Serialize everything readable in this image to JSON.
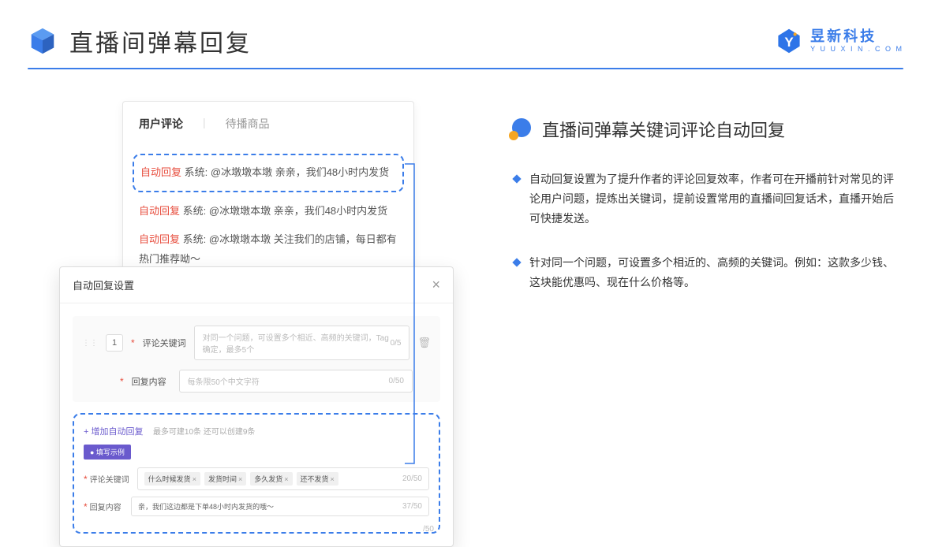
{
  "header": {
    "title": "直播间弹幕回复",
    "brand_cn": "昱新科技",
    "brand_en": "Y U U X I N . C O M"
  },
  "comments": {
    "tabs": {
      "active": "用户评论",
      "inactive": "待播商品"
    },
    "items": [
      {
        "tag": "自动回复",
        "sys": "系统:",
        "text": "@冰墩墩本墩 亲亲，我们48小时内发货"
      },
      {
        "tag": "自动回复",
        "sys": "系统:",
        "text": "@冰墩墩本墩 亲亲，我们48小时内发货"
      },
      {
        "tag": "自动回复",
        "sys": "系统:",
        "text": "@冰墩墩本墩 关注我们的店铺，每日都有热门推荐呦～"
      }
    ]
  },
  "dialog": {
    "title": "自动回复设置",
    "index": "1",
    "field1": {
      "label": "评论关键词",
      "placeholder": "对同一个问题，可设置多个相近、高频的关键词，Tag确定，最多5个",
      "count": "0/5"
    },
    "field2": {
      "label": "回复内容",
      "placeholder": "每条限50个中文字符",
      "count": "0/50"
    },
    "add_link": "+ 增加自动回复",
    "add_hint": "最多可建10条 还可以创建9条",
    "example_badge": "● 填写示例",
    "ex1": {
      "label": "评论关键词",
      "tags": [
        "什么时候发货",
        "发货时间",
        "多久发货",
        "还不发货"
      ],
      "count": "20/50"
    },
    "ex2": {
      "label": "回复内容",
      "text": "亲，我们这边都是下单48小时内发货的哦～",
      "count": "37/50"
    },
    "orphan": "/50"
  },
  "right": {
    "feature_title": "直播间弹幕关键词评论自动回复",
    "desc1": "自动回复设置为了提升作者的评论回复效率，作者可在开播前针对常见的评论用户问题，提炼出关键词，提前设置常用的直播间回复话术，直播开始后可快捷发送。",
    "desc2": "针对同一个问题，可设置多个相近的、高频的关键词。例如：这款多少钱、这块能优惠吗、现在什么价格等。"
  }
}
